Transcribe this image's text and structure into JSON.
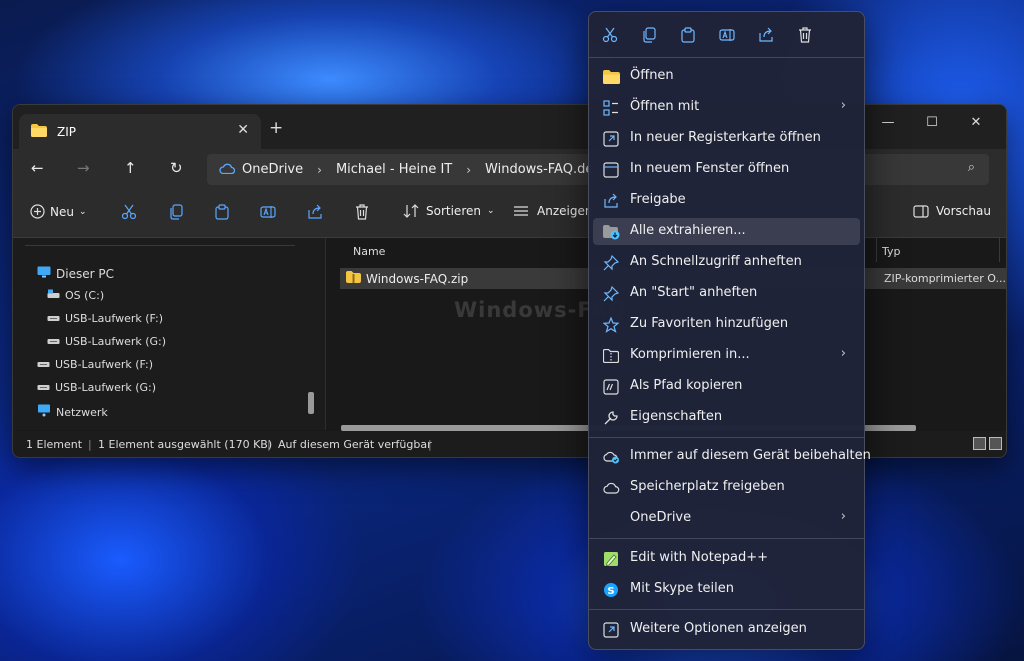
{
  "explorer": {
    "tab_title": "ZIP",
    "breadcrumb": [
      "OneDrive",
      "Michael - Heine IT",
      "Windows-FAQ.de"
    ],
    "toolbar": {
      "new_label": "Neu",
      "sort_label": "Sortieren",
      "view_label": "Anzeigen",
      "preview_label": "Vorschau"
    },
    "nav": [
      "Dieser PC",
      "OS (C:)",
      "USB-Laufwerk (F:)",
      "USB-Laufwerk (G:)",
      "USB-Laufwerk (F:)",
      "USB-Laufwerk (G:)",
      "Netzwerk"
    ],
    "columns": {
      "name": "Name",
      "type": "Typ"
    },
    "file": {
      "name": "Windows-FAQ.zip",
      "type": "ZIP-komprimierter O..."
    },
    "watermark": "Windows-FAQ",
    "status": [
      "1 Element",
      "1 Element ausgewählt (170 KB)",
      "Auf diesem Gerät verfügbar"
    ]
  },
  "context_menu": {
    "quick_actions": [
      "cut-icon",
      "copy-icon",
      "paste-icon",
      "rename-icon",
      "share-icon",
      "delete-icon"
    ],
    "items": [
      {
        "label": "Öffnen",
        "icon": "folder-icon",
        "submenu": false
      },
      {
        "label": "Öffnen mit",
        "icon": "open-with-icon",
        "submenu": true
      },
      {
        "label": "In neuer Registerkarte öffnen",
        "icon": "new-tab-icon",
        "submenu": false
      },
      {
        "label": "In neuem Fenster öffnen",
        "icon": "new-window-icon",
        "submenu": false
      },
      {
        "label": "Freigabe",
        "icon": "share-icon",
        "submenu": false
      },
      {
        "label": "Alle extrahieren...",
        "icon": "extract-icon",
        "submenu": false,
        "highlighted": true
      },
      {
        "label": "An Schnellzugriff anheften",
        "icon": "pin-icon",
        "submenu": false
      },
      {
        "label": "An \"Start\" anheften",
        "icon": "pin-start-icon",
        "submenu": false
      },
      {
        "label": "Zu Favoriten hinzufügen",
        "icon": "star-icon",
        "submenu": false
      },
      {
        "label": "Komprimieren in...",
        "icon": "compress-icon",
        "submenu": true
      },
      {
        "label": "Als Pfad kopieren",
        "icon": "copy-path-icon",
        "submenu": false
      },
      {
        "label": "Eigenschaften",
        "icon": "wrench-icon",
        "submenu": false
      },
      {
        "label": "Immer auf diesem Gerät beibehalten",
        "icon": "cloud-keep-icon",
        "submenu": false
      },
      {
        "label": "Speicherplatz freigeben",
        "icon": "cloud-icon",
        "submenu": false
      },
      {
        "label": "OneDrive",
        "icon": "",
        "submenu": true
      },
      {
        "label": "Edit with Notepad++",
        "icon": "notepad-icon",
        "submenu": false
      },
      {
        "label": "Mit Skype teilen",
        "icon": "skype-icon",
        "submenu": false
      },
      {
        "label": "Weitere Optionen anzeigen",
        "icon": "more-options-icon",
        "submenu": false
      }
    ]
  },
  "colors": {
    "accent": "#4cc2ff",
    "folder": "#f4c542",
    "menu_bg": "#202438",
    "explorer_bg": "#191919"
  }
}
